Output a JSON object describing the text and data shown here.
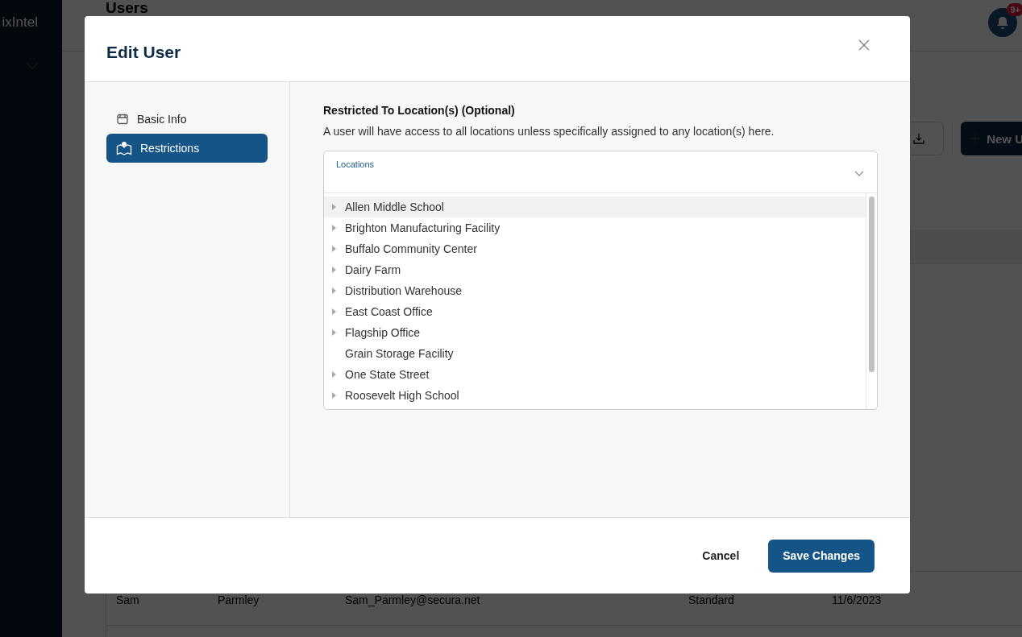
{
  "app": {
    "logo": "ixIntel",
    "page_title": "Users",
    "notification_badge": "9+",
    "new_button": "New U",
    "visible_row": {
      "first_name": "Sam",
      "last_name": "Parmley",
      "email": "Sam_Parmley@secura.net",
      "role": "Standard",
      "date": "11/6/2023"
    }
  },
  "dialog": {
    "title": "Edit User",
    "nav": [
      {
        "label": "Basic Info",
        "kind": "calendar",
        "selected": false
      },
      {
        "label": "Restrictions",
        "kind": "map",
        "selected": true
      }
    ],
    "section_title": "Restricted To Location(s) (Optional)",
    "description": "A user will have access to all locations unless specifically assigned to any location(s) here.",
    "select_label": "Locations",
    "locations": [
      {
        "name": "Allen Middle School",
        "expandable": true,
        "selected": true
      },
      {
        "name": "Brighton Manufacturing Facility",
        "expandable": true,
        "selected": false
      },
      {
        "name": "Buffalo Community Center",
        "expandable": true,
        "selected": false
      },
      {
        "name": "Dairy Farm",
        "expandable": true,
        "selected": false
      },
      {
        "name": "Distribution Warehouse",
        "expandable": true,
        "selected": false
      },
      {
        "name": "East Coast Office",
        "expandable": true,
        "selected": false
      },
      {
        "name": "Flagship Office",
        "expandable": true,
        "selected": false
      },
      {
        "name": "Grain Storage Facility",
        "expandable": false,
        "selected": false
      },
      {
        "name": "One State Street",
        "expandable": true,
        "selected": false
      },
      {
        "name": "Roosevelt High School",
        "expandable": true,
        "selected": false
      }
    ],
    "buttons": {
      "cancel": "Cancel",
      "save": "Save Changes"
    }
  }
}
